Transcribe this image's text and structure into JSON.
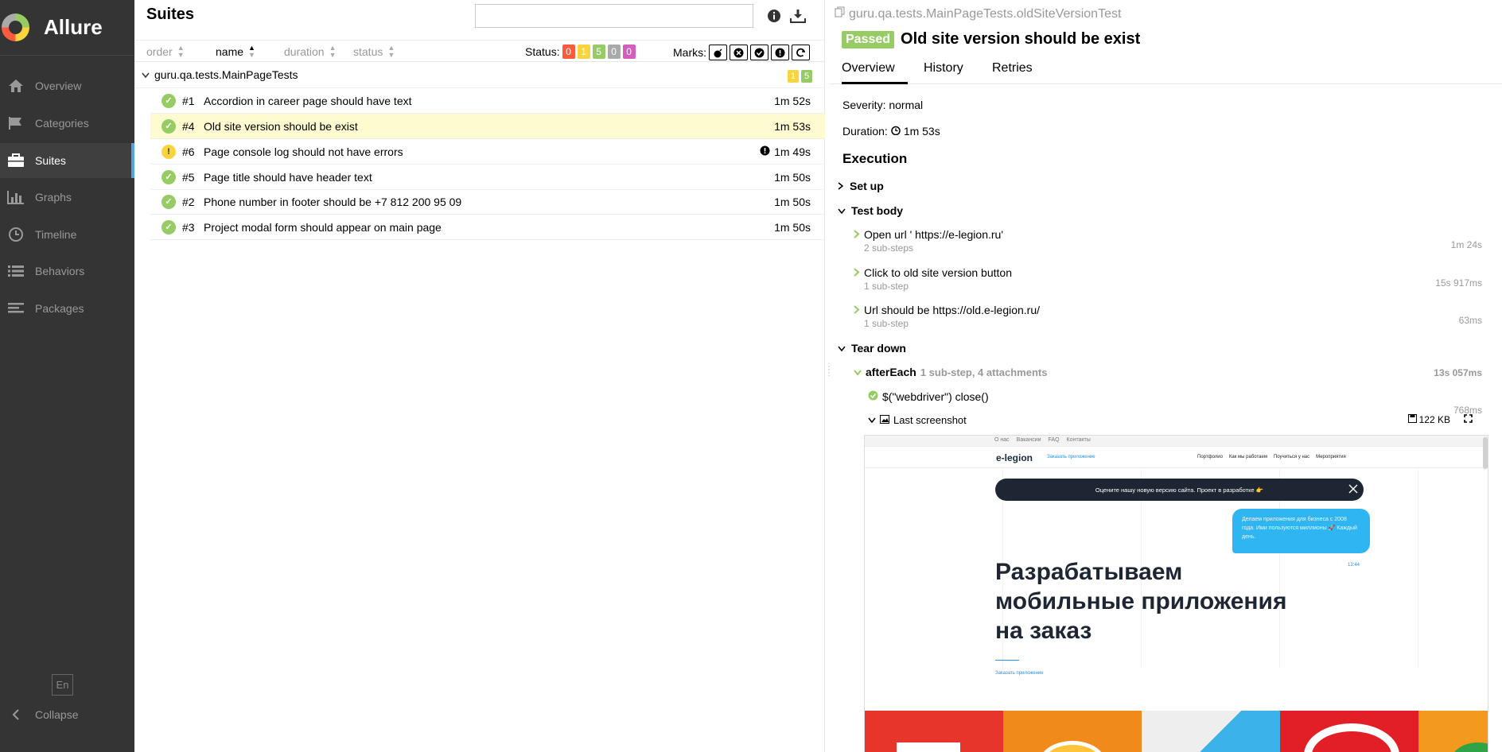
{
  "sidebar": {
    "brand": "Allure",
    "items": [
      {
        "label": "Overview",
        "icon": "home-icon"
      },
      {
        "label": "Categories",
        "icon": "flag-icon"
      },
      {
        "label": "Suites",
        "icon": "briefcase-icon",
        "active": true
      },
      {
        "label": "Graphs",
        "icon": "bar-chart-icon"
      },
      {
        "label": "Timeline",
        "icon": "clock-icon"
      },
      {
        "label": "Behaviors",
        "icon": "list-icon"
      },
      {
        "label": "Packages",
        "icon": "align-left-icon"
      }
    ],
    "lang": "En",
    "collapse": "Collapse"
  },
  "suites": {
    "title": "Suites",
    "search_value": "",
    "sort": {
      "order": "order",
      "name": "name",
      "duration": "duration",
      "status": "status"
    },
    "status_label": "Status:",
    "status_counts": [
      {
        "value": "0",
        "color": "#fd5a3e"
      },
      {
        "value": "1",
        "color": "#fad43f"
      },
      {
        "value": "5",
        "color": "#97cc64"
      },
      {
        "value": "0",
        "color": "#aaaaaa"
      },
      {
        "value": "0",
        "color": "#d35ebe"
      }
    ],
    "marks_label": "Marks:",
    "group": {
      "name": "guru.qa.tests.MainPageTests",
      "broken": "1",
      "passed": "5"
    },
    "rows": [
      {
        "num": "#1",
        "name": "Accordion in career page should have text",
        "duration": "1m 52s",
        "status": "passed"
      },
      {
        "num": "#4",
        "name": "Old site version should be exist",
        "duration": "1m 53s",
        "status": "passed",
        "selected": true
      },
      {
        "num": "#6",
        "name": "Page console log should not have errors",
        "duration": "1m 49s",
        "status": "broken"
      },
      {
        "num": "#5",
        "name": "Page title should have header text",
        "duration": "1m 50s",
        "status": "passed"
      },
      {
        "num": "#2",
        "name": "Phone number in footer should be +7 812 200 95 09",
        "duration": "1m 50s",
        "status": "passed"
      },
      {
        "num": "#3",
        "name": "Project modal form should appear on main page",
        "duration": "1m 50s",
        "status": "passed"
      }
    ]
  },
  "testcase": {
    "breadcrumb": "guru.qa.tests.MainPageTests.oldSiteVersionTest",
    "status": "Passed",
    "title": "Old site version should be exist",
    "tabs": [
      "Overview",
      "History",
      "Retries"
    ],
    "severity_label": "Severity:",
    "severity": "normal",
    "duration_label": "Duration:",
    "duration": "1m 53s",
    "execution": "Execution",
    "setup": "Set up",
    "test_body": "Test body",
    "steps": [
      {
        "name": "Open url ' https://e-legion.ru'",
        "sub": "2 sub-steps",
        "duration": "1m 24s"
      },
      {
        "name": "Click to old site version button",
        "sub": "1 sub-step",
        "duration": "15s 917ms"
      },
      {
        "name": "Url should be https://old.e-legion.ru/",
        "sub": "1 sub-step",
        "duration": "63ms"
      }
    ],
    "teardown": "Tear down",
    "after_each": {
      "name": "afterEach",
      "info": "1 sub-step, 4 attachments",
      "duration": "13s 057ms"
    },
    "close_step": {
      "name": "$(\"webdriver\") close()",
      "duration": "768ms"
    },
    "attachment": {
      "name": "Last screenshot",
      "size": "122 KB"
    }
  },
  "screenshot": {
    "topnav": [
      "О нас",
      "Вакансии",
      "FAQ",
      "Контакты"
    ],
    "logo": "e-legion",
    "order_link": "Заказать приложение",
    "menu": [
      "Портфолио",
      "Как мы работаем",
      "Поучиться у нас",
      "Мероприятия"
    ],
    "banner": "Оцените нашу новую версию сайта. Проект в разработке 👉",
    "bubble": "Делаем приложения для бизнеса с 2008 года. Ими пользуются миллионы 🚀 Каждый день.",
    "bubble_time": "13:44",
    "hero": [
      "Разрабатываем",
      "мобильные приложения",
      "на заказ"
    ],
    "cta": "Заказать приложение"
  }
}
